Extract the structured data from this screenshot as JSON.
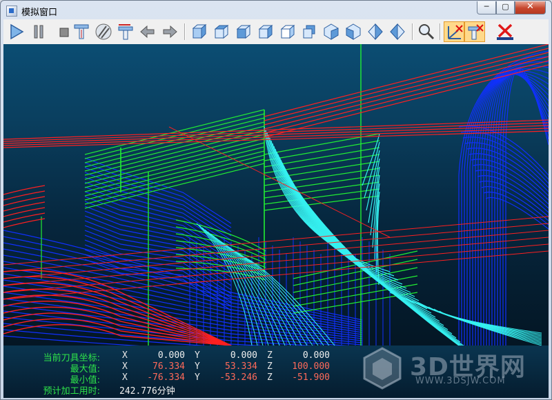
{
  "window": {
    "title": "模拟窗口",
    "min_label": "─",
    "max_label": "▢",
    "close_label": "✕"
  },
  "toolbar": {
    "buttons": [
      {
        "name": "play-icon"
      },
      {
        "name": "pause-icon"
      },
      {
        "name": "stop-icon"
      },
      {
        "name": "tool-down-icon"
      },
      {
        "name": "hatch-icon"
      },
      {
        "name": "tool-up-icon"
      },
      {
        "name": "arrow-left-icon"
      },
      {
        "name": "arrow-right-icon"
      },
      {
        "name": "view-iso-icon"
      },
      {
        "name": "view-top-icon"
      },
      {
        "name": "view-left-icon"
      },
      {
        "name": "view-right-icon"
      },
      {
        "name": "view-front-icon"
      },
      {
        "name": "view-back-icon"
      },
      {
        "name": "view-diamond-1-icon"
      },
      {
        "name": "view-diamond-2-icon"
      },
      {
        "name": "view-diamond-3-icon"
      },
      {
        "name": "view-diamond-4-icon"
      },
      {
        "name": "zoom-icon"
      },
      {
        "name": "axis-toggle-icon"
      },
      {
        "name": "tool-toggle-icon"
      },
      {
        "name": "clear-icon"
      }
    ]
  },
  "status": {
    "current_label": "当前刀具坐标:",
    "max_label": "最大值:",
    "min_label": "最小值:",
    "time_label": "预计加工用时:",
    "x_label": "X",
    "y_label": "Y",
    "z_label": "Z",
    "current": {
      "x": "0.000",
      "y": "0.000",
      "z": "0.000"
    },
    "max": {
      "x": "76.334",
      "y": "53.334",
      "z": "100.000"
    },
    "min": {
      "x": "-76.334",
      "y": "-53.246",
      "z": "-51.900"
    },
    "time_value": "242.776分钟"
  },
  "watermark": {
    "brand": "3D世界网",
    "url": "WWW.3DSJW.COM"
  },
  "colors": {
    "rapid": "#ff2020",
    "cut_blue": "#1030ff",
    "cut_cyan": "#35f0f0",
    "cut_green": "#22ee33"
  }
}
